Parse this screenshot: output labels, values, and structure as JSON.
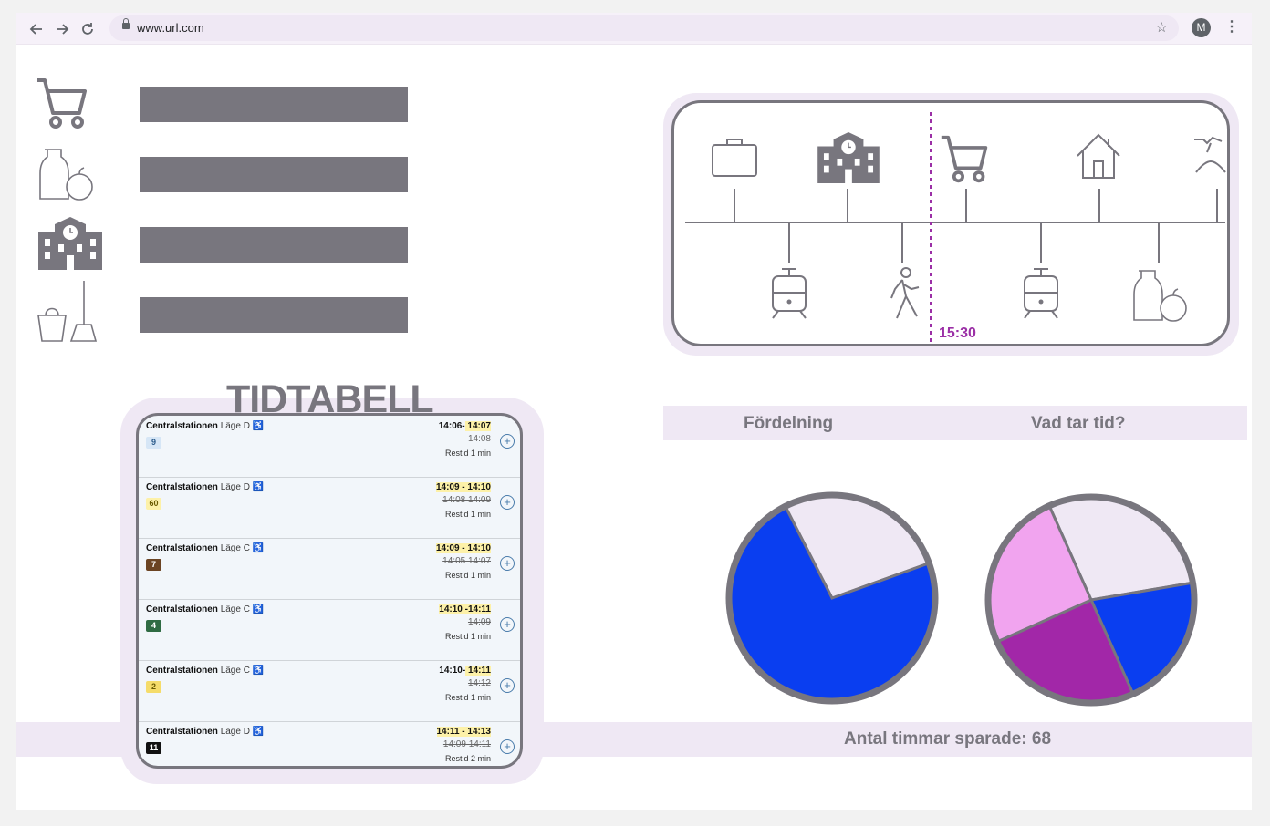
{
  "browser": {
    "url": "www.url.com",
    "avatar_initial": "M",
    "back_icon": "arrow-left-icon",
    "forward_icon": "arrow-right-icon",
    "reload_icon": "reload-icon"
  },
  "activity_list": {
    "items": [
      {
        "icon": "shopping-cart-icon"
      },
      {
        "icon": "groceries-icon"
      },
      {
        "icon": "school-icon"
      },
      {
        "icon": "cleaning-icon"
      }
    ]
  },
  "timeline": {
    "current_time": "15:30",
    "accent_color": "#9b2fa6",
    "top_icons": [
      "briefcase-icon",
      "school-icon",
      "shopping-cart-icon",
      "home-icon",
      "clothes-hanger-icon"
    ],
    "bottom_icons": [
      "tram-icon",
      "walking-person-icon",
      "tram-icon",
      "groceries-icon"
    ]
  },
  "timetable": {
    "title": "TIDTABELL",
    "rows": [
      {
        "station": "Centralstationen",
        "stop": "Läge D",
        "line": "9",
        "line_bg": "#d6e6f6",
        "line_fg": "#2a5a8a",
        "times_pre": "14:06-",
        "times_hl": " 14:07",
        "old": "14:08",
        "restid": "Restid 1 min"
      },
      {
        "station": "Centralstationen",
        "stop": "Läge D",
        "line": "60",
        "line_bg": "#fdf1a8",
        "line_fg": "#6a5a00",
        "times_pre": "",
        "times_hl": "14:09 - 14:10",
        "old": "14:08    14:09",
        "restid": "Restid 1 min"
      },
      {
        "station": "Centralstationen",
        "stop": "Läge C",
        "line": "7",
        "line_bg": "#6b4423",
        "line_fg": "#ffffff",
        "times_pre": "",
        "times_hl": "14:09 - 14:10",
        "old": "14:05    14:07",
        "restid": "Restid 1 min"
      },
      {
        "station": "Centralstationen",
        "stop": "Läge C",
        "line": "4",
        "line_bg": "#2f6b43",
        "line_fg": "#ffffff",
        "times_pre": "",
        "times_hl": "14:10 -14:11",
        "old": "14:09",
        "restid": "Restid 1 min"
      },
      {
        "station": "Centralstationen",
        "stop": "Läge C",
        "line": "2",
        "line_bg": "#f5dc6a",
        "line_fg": "#6a5a00",
        "times_pre": "14:10-",
        "times_hl": " 14:11",
        "old": "14:12",
        "restid": "Restid 1 min"
      },
      {
        "station": "Centralstationen",
        "stop": "Läge D",
        "line": "11",
        "line_bg": "#111111",
        "line_fg": "#ffffff",
        "times_pre": "",
        "times_hl": "14:11 - 14:13",
        "old": "14:09    14:11",
        "restid": "Restid 2 min"
      }
    ]
  },
  "charts_header": {
    "left": "Fördelning",
    "right": "Vad tar tid?"
  },
  "chart_data": [
    {
      "type": "pie",
      "title": "Fördelning",
      "values": [
        27,
        73
      ],
      "colors": [
        "#efe8f4",
        "#0a3ef0"
      ]
    },
    {
      "type": "pie",
      "title": "Vad tar tid?",
      "values": [
        29,
        21,
        25,
        25
      ],
      "colors": [
        "#efe8f4",
        "#0a3ef0",
        "#a227a8",
        "#f1a4ef"
      ]
    }
  ],
  "footer": {
    "text": "Antal timmar sparade: 68"
  }
}
